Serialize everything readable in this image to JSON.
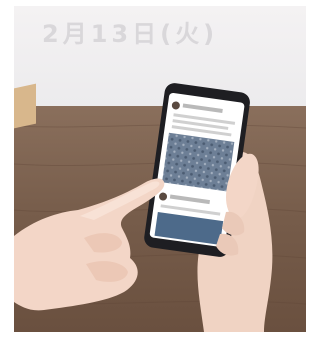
{
  "photo": {
    "wall_text": "2月13日(火)",
    "subject": "hands-holding-smartphone",
    "colors": {
      "wall": "#efedee",
      "desk": "#7a604e",
      "skin": "#f3d6c7",
      "phone": "#1e1e22",
      "screen": "#ffffff",
      "post_image": "#6d7f96"
    }
  }
}
